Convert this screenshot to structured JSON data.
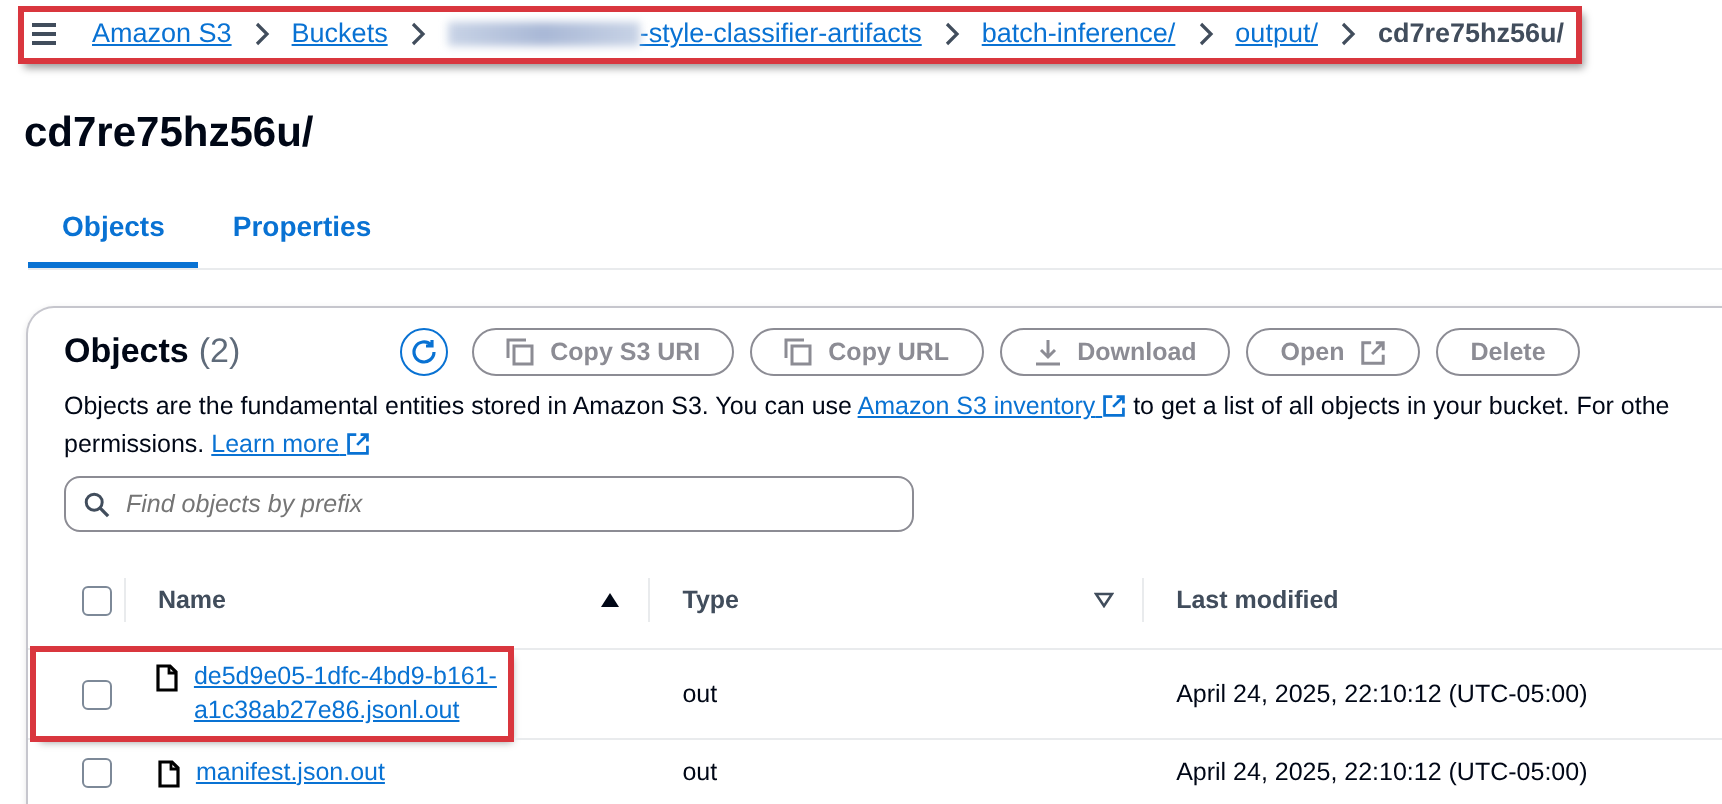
{
  "breadcrumb": [
    {
      "kind": "link",
      "label": "Amazon S3"
    },
    {
      "kind": "link",
      "label": "Buckets"
    },
    {
      "kind": "redacted"
    },
    {
      "kind": "link",
      "label": "-style-classifier-artifacts"
    },
    {
      "kind": "link",
      "label": "batch-inference/"
    },
    {
      "kind": "link",
      "label": "output/"
    },
    {
      "kind": "current",
      "label": "cd7re75hz56u/"
    }
  ],
  "title": "cd7re75hz56u/",
  "tabs": [
    {
      "label": "Objects",
      "selected": true
    },
    {
      "label": "Properties",
      "selected": false
    }
  ],
  "panel": {
    "title": "Objects",
    "count": "(2)",
    "buttons": [
      {
        "kind": "refresh"
      },
      {
        "kind": "copy",
        "label": "Copy S3 URI"
      },
      {
        "kind": "copy",
        "label": "Copy URL"
      },
      {
        "kind": "download",
        "label": "Download"
      },
      {
        "kind": "open",
        "label": "Open"
      },
      {
        "kind": "plain",
        "label": "Delete"
      }
    ],
    "description": {
      "before": "Objects are the fundamental entities stored in Amazon S3. You can use ",
      "link": "Amazon S3 inventory",
      "after": " to get a list of all objects in your bucket. For othe",
      "line2": "permissions. ",
      "link2": "Learn more"
    },
    "search": {
      "placeholder": "Find objects by prefix"
    },
    "all_checked": false,
    "columns": [
      {
        "label": "Name",
        "kind": "sorted_ascending"
      },
      {
        "label": "Type",
        "kind": "sortable"
      },
      {
        "label": "Last modified",
        "kind": "plain"
      }
    ],
    "rows": [
      {
        "name_lines": [
          "de5d9e05-1dfc-4bd9-b161-",
          "a1c38ab27e86.jsonl.out"
        ],
        "type": "out",
        "modified": "April 24, 2025, 22:10:12 (UTC-05:00)",
        "checked": false,
        "highlighted": true
      },
      {
        "name_lines": [
          "manifest.json.out"
        ],
        "type": "out",
        "modified": "April 24, 2025, 22:10:12 (UTC-05:00)",
        "checked": false,
        "highlighted": false
      }
    ]
  }
}
